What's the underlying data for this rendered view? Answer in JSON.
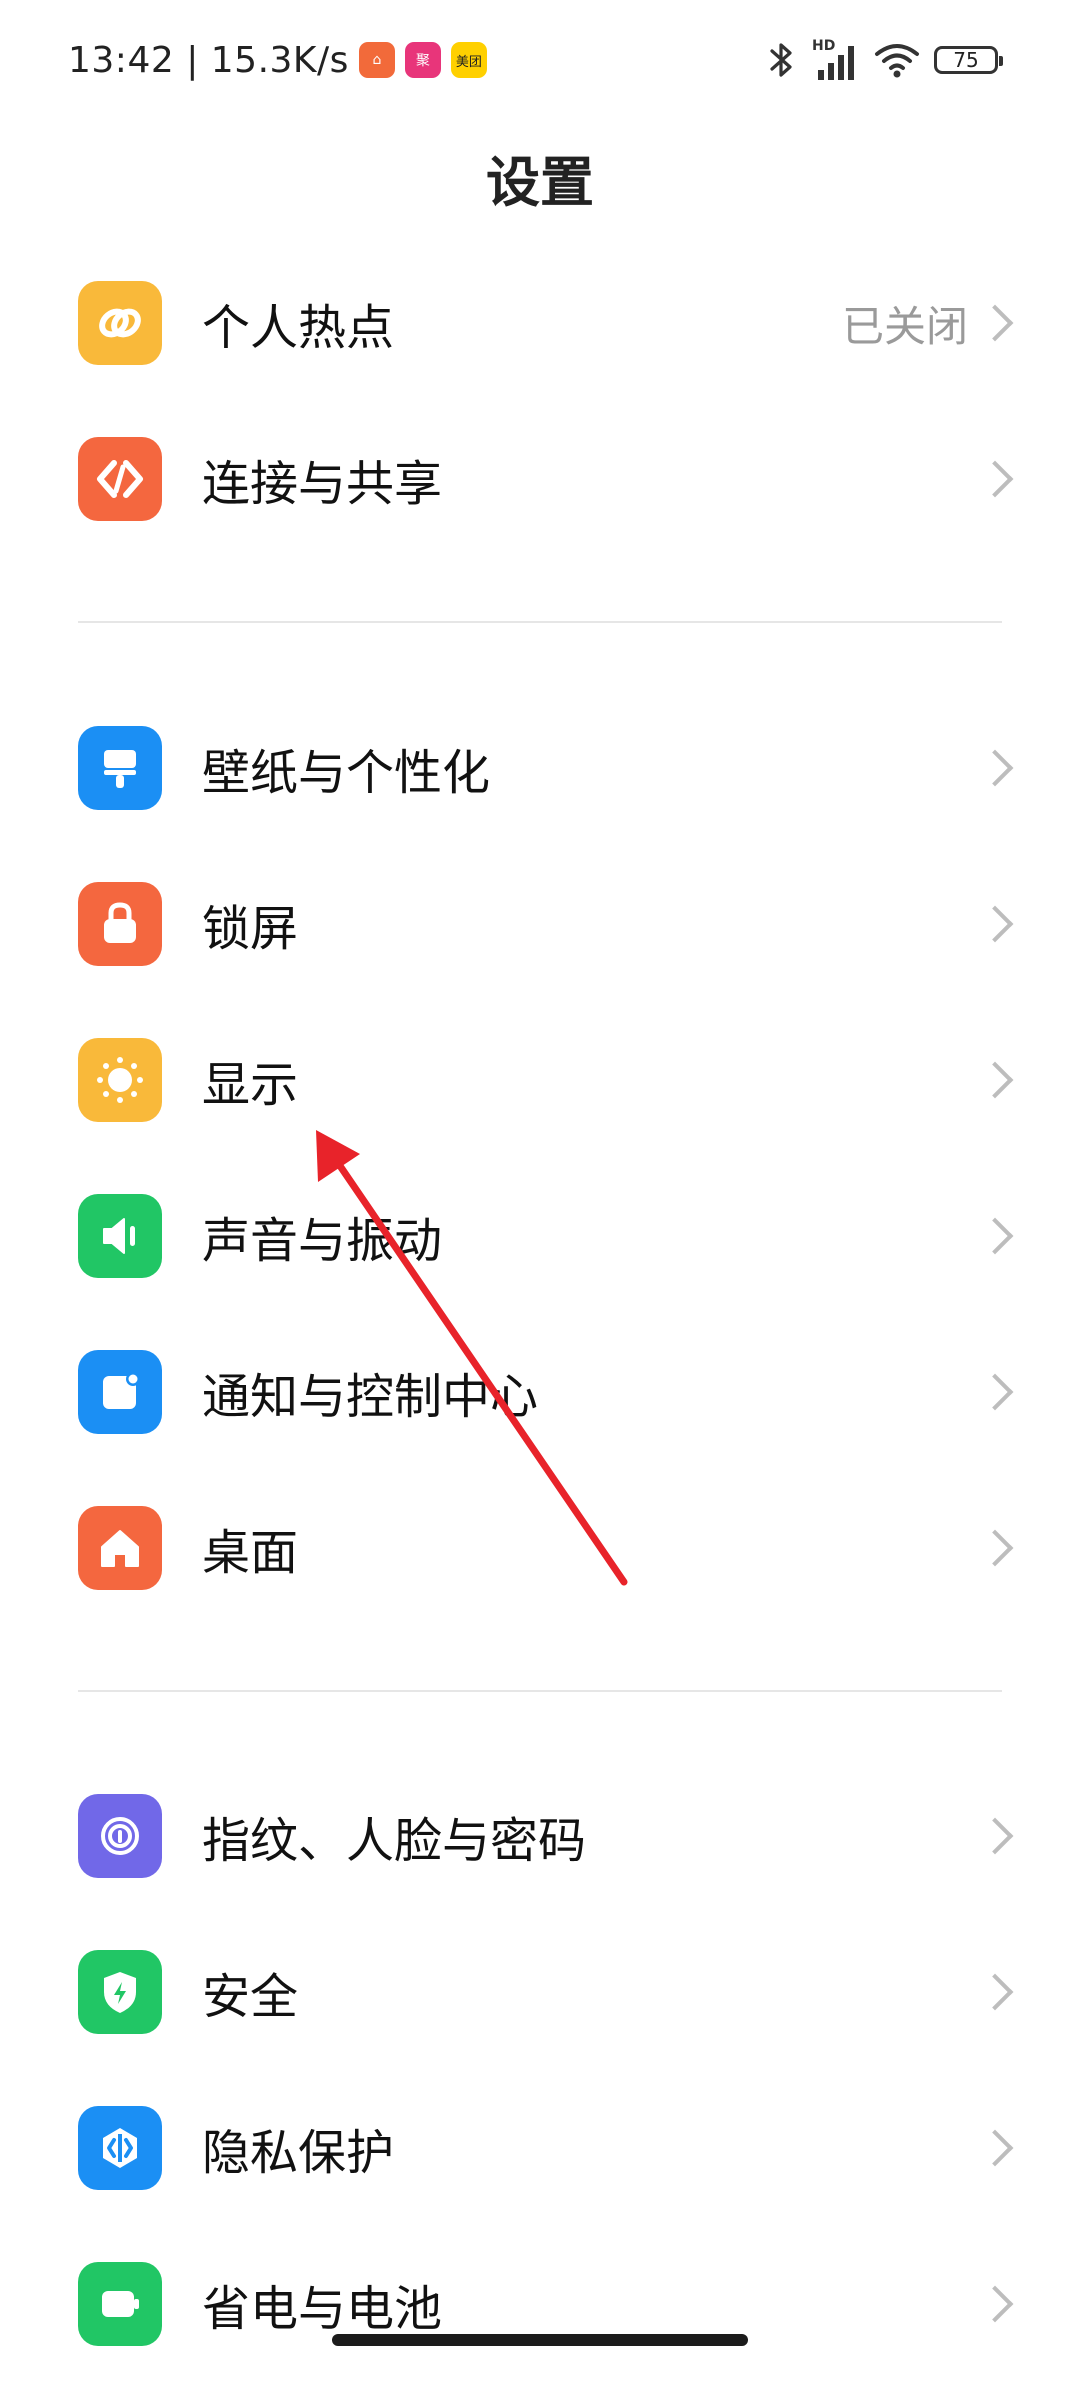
{
  "status_bar": {
    "time_speed": "13:42 | 15.3K/s",
    "app_badges": [
      {
        "name": "app-badge-1",
        "color": "#f26a3a",
        "text": "⌂"
      },
      {
        "name": "app-badge-2",
        "color": "#e8357a",
        "text": "聚"
      },
      {
        "name": "meituan-badge",
        "color": "#ffd000",
        "text": "美团"
      }
    ],
    "network_label": "HD",
    "battery_level": "75",
    "icons": [
      "bluetooth-icon",
      "signal-icon",
      "wifi-icon",
      "battery-icon"
    ]
  },
  "header": {
    "title": "设置"
  },
  "groups": [
    {
      "items": [
        {
          "name": "personal-hotspot",
          "label": "个人热点",
          "value": "已关闭",
          "icon": "hotspot-link-icon",
          "color": "#f9b93a"
        },
        {
          "name": "connection-sharing",
          "label": "连接与共享",
          "value": "",
          "icon": "share-diamond-icon",
          "color": "#f4673f"
        }
      ]
    },
    {
      "items": [
        {
          "name": "wallpaper-personalization",
          "label": "壁纸与个性化",
          "icon": "brush-icon",
          "color": "#1b8ff4"
        },
        {
          "name": "lock-screen",
          "label": "锁屏",
          "icon": "lock-icon",
          "color": "#f4673f"
        },
        {
          "name": "display",
          "label": "显示",
          "icon": "sun-icon",
          "color": "#f9b93a"
        },
        {
          "name": "sound-vibration",
          "label": "声音与振动",
          "icon": "speaker-icon",
          "color": "#21c665"
        },
        {
          "name": "notification-control-center",
          "label": "通知与控制中心",
          "icon": "notification-icon",
          "color": "#1b8ff4"
        },
        {
          "name": "desktop",
          "label": "桌面",
          "icon": "home-icon",
          "color": "#f4673f"
        }
      ]
    },
    {
      "items": [
        {
          "name": "fingerprint-face-password",
          "label": "指纹、人脸与密码",
          "icon": "fingerprint-icon",
          "color": "#7168e8"
        },
        {
          "name": "security",
          "label": "安全",
          "icon": "shield-icon",
          "color": "#21c665"
        },
        {
          "name": "privacy-protection",
          "label": "隐私保护",
          "icon": "privacy-icon",
          "color": "#1b8ff4"
        },
        {
          "name": "battery-saver",
          "label": "省电与电池",
          "icon": "battery-saver-icon",
          "color": "#21c665"
        }
      ]
    }
  ],
  "colors": {
    "annotation_arrow": "#e8232a",
    "chevron": "#bdbdbd",
    "value_text": "#9a9a9a"
  }
}
